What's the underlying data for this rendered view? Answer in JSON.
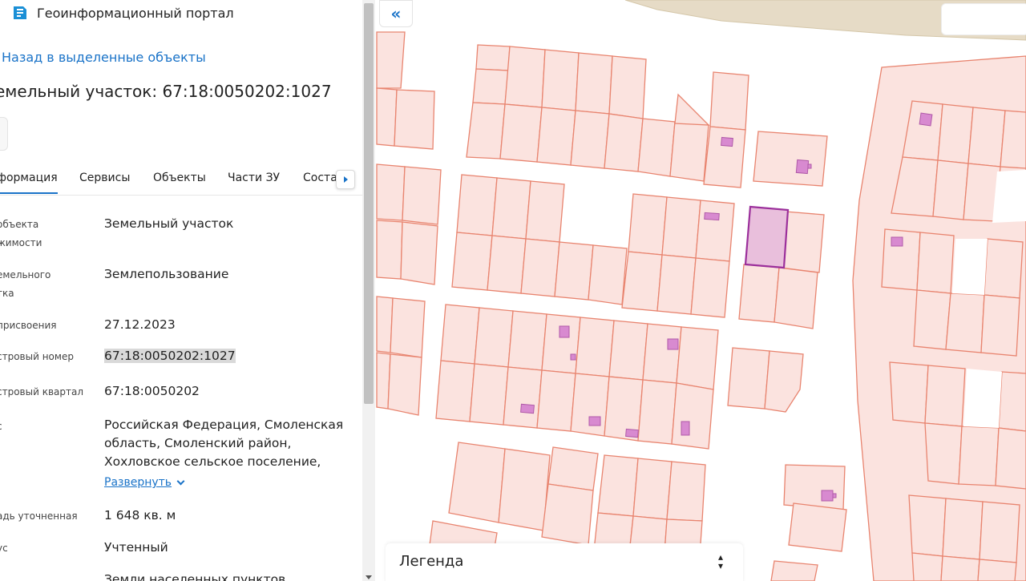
{
  "header": {
    "app_title": "Геоинформационный портал"
  },
  "nav": {
    "back_link": "Назад в выделенные объекты"
  },
  "object": {
    "title": "емельный участок: 67:18:0050202:1027"
  },
  "tabs": [
    {
      "label": "формация",
      "active": true
    },
    {
      "label": "Сервисы",
      "active": false
    },
    {
      "label": "Объекты",
      "active": false
    },
    {
      "label": "Части ЗУ",
      "active": false
    },
    {
      "label": "Соста",
      "active": false
    }
  ],
  "info": {
    "rows": [
      {
        "label_lines": [
          "объекта",
          "жимости"
        ],
        "value": "Земельный участок"
      },
      {
        "label_lines": [
          "емельного",
          "тка"
        ],
        "value": "Землепользование"
      },
      {
        "label_lines": [
          "присвоения"
        ],
        "value": "27.12.2023"
      },
      {
        "label_lines": [
          "стровый номер"
        ],
        "value": "67:18:0050202:1027",
        "highlighted": true
      },
      {
        "label_lines": [
          "стровый квартал"
        ],
        "value": "67:18:0050202"
      },
      {
        "label_lines": [
          "с"
        ],
        "value_lines": [
          "Российская Федерация, Смоленская",
          "область, Смоленский район,",
          "Хохловское сельское поселение,"
        ],
        "expand_label": "Развернуть"
      },
      {
        "label_lines": [
          "адь уточненная"
        ],
        "value": "1 648 кв. м"
      },
      {
        "label_lines": [
          "ус"
        ],
        "value": "Учтенный"
      },
      {
        "label_lines": [],
        "value": "Земли населенных пунктов"
      }
    ]
  },
  "map": {
    "legend_label": "Легенда",
    "colors": {
      "parcel_fill": "#fbe3df",
      "parcel_stroke": "#e8846f",
      "building_fill": "#d88ad0",
      "selected_fill": "#e9bfdc",
      "selected_stroke": "#9b2f9b",
      "terrain": "#e6dbc6"
    }
  }
}
